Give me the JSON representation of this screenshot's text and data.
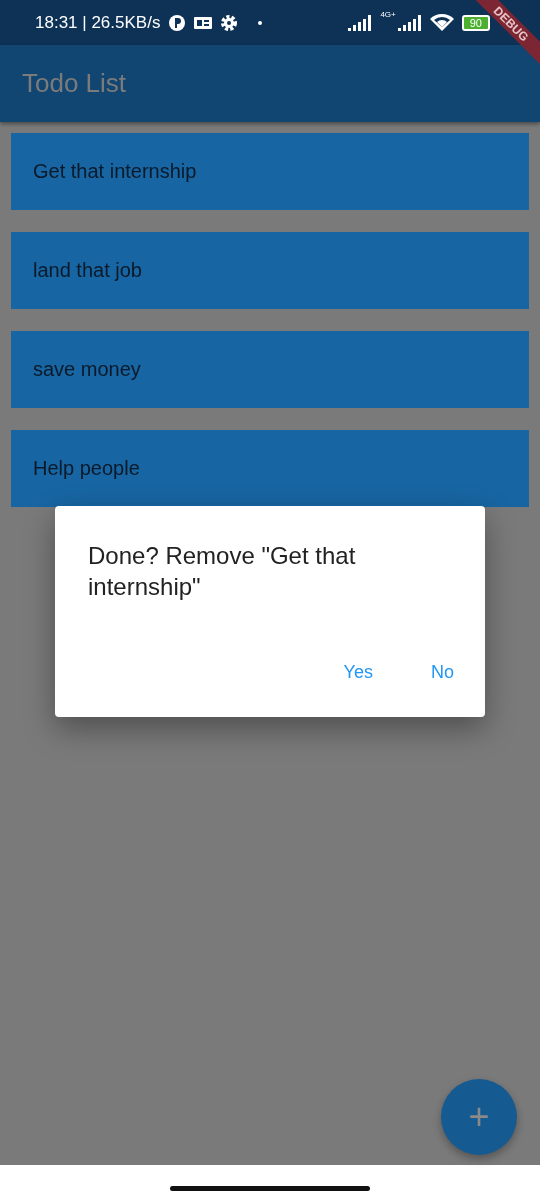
{
  "status_bar": {
    "time": "18:31 | 26.5KB/s",
    "network_label": "4G+",
    "battery": "90"
  },
  "debug_banner": "DEBUG",
  "app_bar": {
    "title": "Todo List"
  },
  "todos": [
    {
      "text": "Get that internship"
    },
    {
      "text": "land that job"
    },
    {
      "text": "save money"
    },
    {
      "text": "Help people"
    }
  ],
  "dialog": {
    "title": "Done? Remove \"Get that internship\"",
    "buttons": [
      "Yes",
      "No"
    ]
  },
  "fab": {
    "label": "+"
  }
}
